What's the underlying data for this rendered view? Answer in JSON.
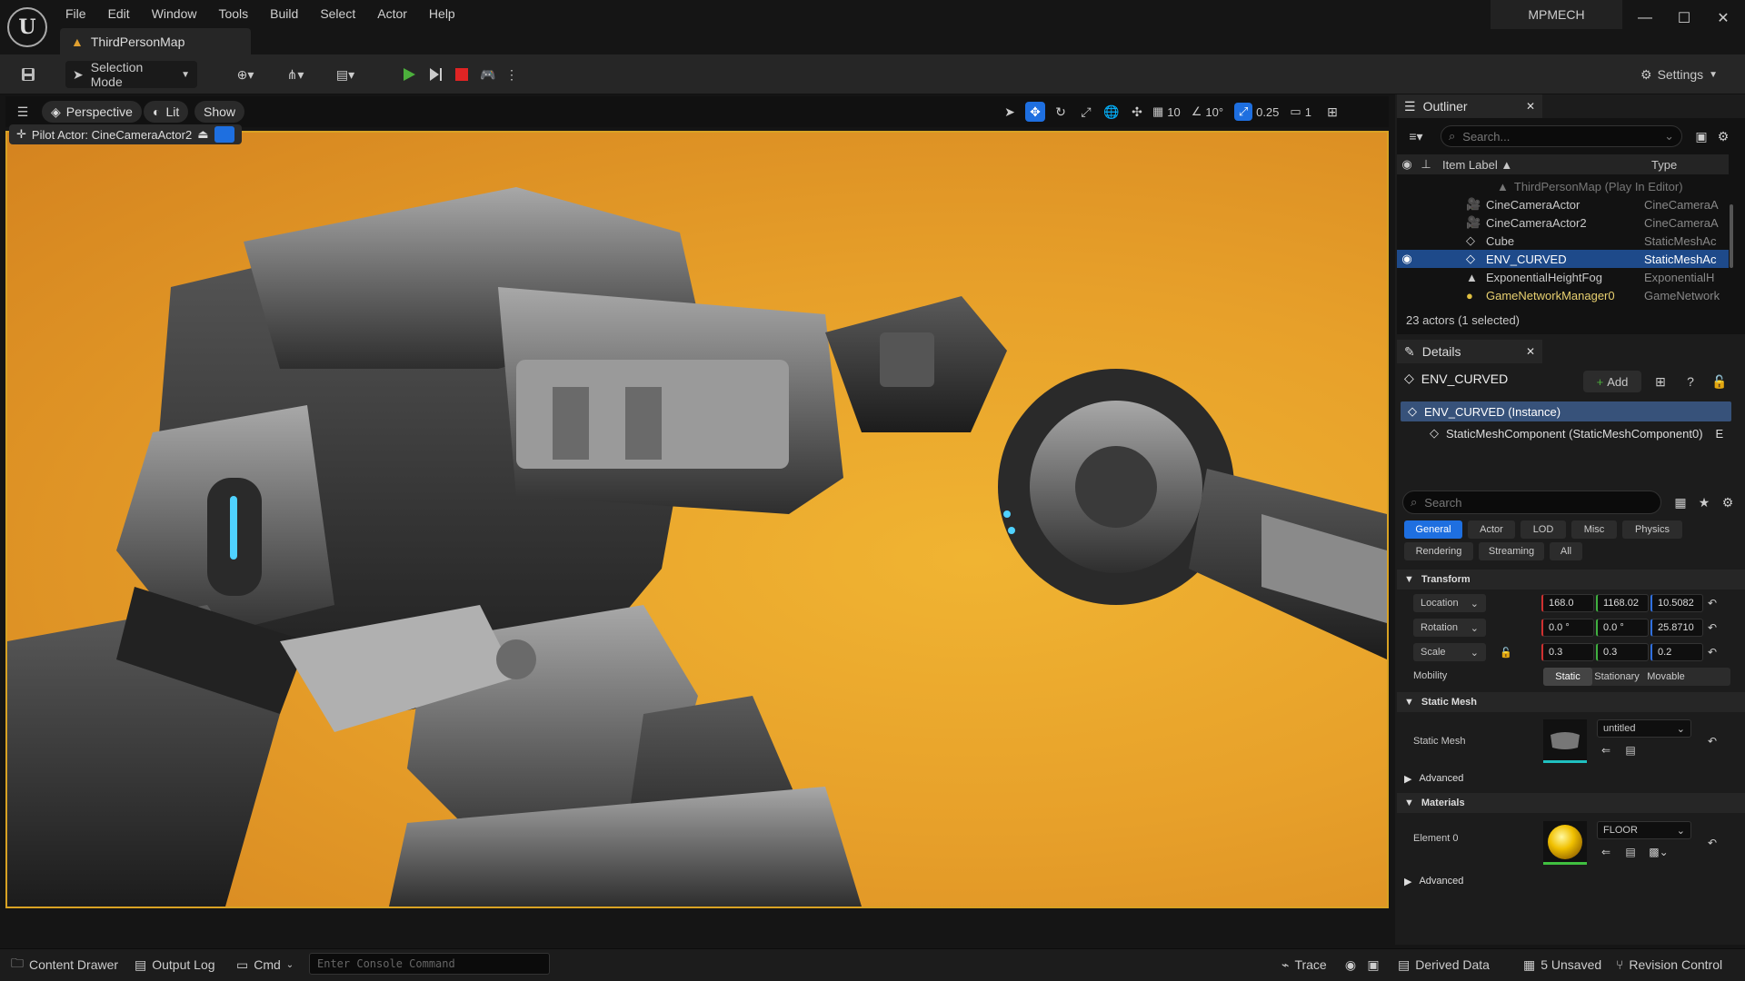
{
  "app": {
    "project": "MPMECH",
    "map_tab": "ThirdPersonMap"
  },
  "menu": [
    "File",
    "Edit",
    "Window",
    "Tools",
    "Build",
    "Select",
    "Actor",
    "Help"
  ],
  "toolbar": {
    "selection_mode": "Selection Mode",
    "settings": "Settings"
  },
  "viewport": {
    "perspective": "Perspective",
    "lit": "Lit",
    "show": "Show",
    "grid_snap": "10",
    "rot_snap": "10°",
    "scale_snap": "0.25",
    "camera_speed": "1",
    "pilot": "Pilot Actor: CineCameraActor2"
  },
  "outliner": {
    "title": "Outliner",
    "search_placeholder": "Search...",
    "col_label": "Item Label ▲",
    "col_type": "Type",
    "root": "ThirdPersonMap (Play In Editor)",
    "items": [
      {
        "label": "CineCameraActor",
        "type": "CineCameraA"
      },
      {
        "label": "CineCameraActor2",
        "type": "CineCameraA"
      },
      {
        "label": "Cube",
        "type": "StaticMeshAc"
      },
      {
        "label": "ENV_CURVED",
        "type": "StaticMeshAc",
        "selected": true
      },
      {
        "label": "ExponentialHeightFog",
        "type": "ExponentialH"
      },
      {
        "label": "GameNetworkManager0",
        "type": "GameNetwork"
      }
    ],
    "count": "23 actors (1 selected)"
  },
  "details": {
    "title": "Details",
    "actor": "ENV_CURVED",
    "add": "Add",
    "instance": "ENV_CURVED (Instance)",
    "component": "StaticMeshComponent (StaticMeshComponent0)",
    "component_suffix": "E",
    "search_placeholder": "Search",
    "filters_row1": [
      "General",
      "Actor",
      "LOD",
      "Misc",
      "Physics"
    ],
    "filters_row2": [
      "Rendering",
      "Streaming",
      "All"
    ],
    "transform": "Transform",
    "location_label": "Location",
    "location": [
      "168.0",
      "1168.02",
      "10.5082"
    ],
    "rotation_label": "Rotation",
    "rotation": [
      "0.0 °",
      "0.0 °",
      "25.8710"
    ],
    "scale_label": "Scale",
    "scale": [
      "0.3",
      "0.3",
      "0.2"
    ],
    "mobility_label": "Mobility",
    "mobility": [
      "Static",
      "Stationary",
      "Movable"
    ],
    "static_mesh_section": "Static Mesh",
    "static_mesh_label": "Static Mesh",
    "static_mesh_value": "untitled",
    "advanced": "Advanced",
    "materials_section": "Materials",
    "element0_label": "Element 0",
    "element0_value": "FLOOR",
    "advanced2": "Advanced"
  },
  "bottom": {
    "content_drawer": "Content Drawer",
    "output_log": "Output Log",
    "cmd": "Cmd",
    "console_placeholder": "Enter Console Command",
    "trace": "Trace",
    "derived_data": "Derived Data",
    "unsaved": "5 Unsaved",
    "revision": "Revision Control"
  },
  "colors": {
    "accent": "#1e6fe0",
    "play": "#4caf3c",
    "stop": "#e02424",
    "viewport_bg": "#e7a02a"
  }
}
